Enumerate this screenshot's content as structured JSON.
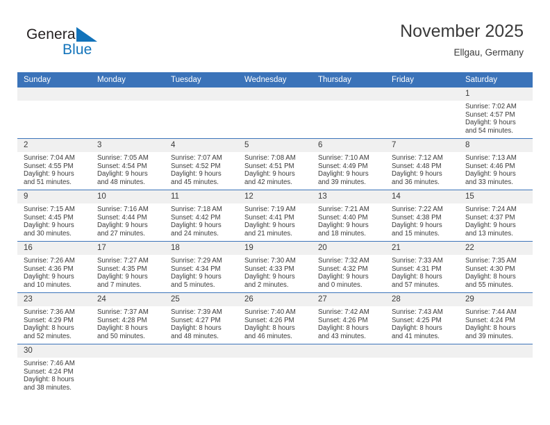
{
  "brand": {
    "name_part1": "General",
    "name_part2": "Blue",
    "flag_icon": "blue-triangle-flag",
    "color_dark": "#231f20",
    "color_blue": "#1273ba"
  },
  "header": {
    "month_title": "November 2025",
    "location": "Ellgau, Germany"
  },
  "theme": {
    "header_blue": "#3b73b9",
    "daynum_band": "#f0f0f0",
    "text": "#3a3a3a"
  },
  "calendar": {
    "weekday_headers": [
      "Sunday",
      "Monday",
      "Tuesday",
      "Wednesday",
      "Thursday",
      "Friday",
      "Saturday"
    ],
    "weeks": [
      [
        {
          "day": "",
          "lines": []
        },
        {
          "day": "",
          "lines": []
        },
        {
          "day": "",
          "lines": []
        },
        {
          "day": "",
          "lines": []
        },
        {
          "day": "",
          "lines": []
        },
        {
          "day": "",
          "lines": []
        },
        {
          "day": "1",
          "lines": [
            "Sunrise: 7:02 AM",
            "Sunset: 4:57 PM",
            "Daylight: 9 hours",
            "and 54 minutes."
          ]
        }
      ],
      [
        {
          "day": "2",
          "lines": [
            "Sunrise: 7:04 AM",
            "Sunset: 4:55 PM",
            "Daylight: 9 hours",
            "and 51 minutes."
          ]
        },
        {
          "day": "3",
          "lines": [
            "Sunrise: 7:05 AM",
            "Sunset: 4:54 PM",
            "Daylight: 9 hours",
            "and 48 minutes."
          ]
        },
        {
          "day": "4",
          "lines": [
            "Sunrise: 7:07 AM",
            "Sunset: 4:52 PM",
            "Daylight: 9 hours",
            "and 45 minutes."
          ]
        },
        {
          "day": "5",
          "lines": [
            "Sunrise: 7:08 AM",
            "Sunset: 4:51 PM",
            "Daylight: 9 hours",
            "and 42 minutes."
          ]
        },
        {
          "day": "6",
          "lines": [
            "Sunrise: 7:10 AM",
            "Sunset: 4:49 PM",
            "Daylight: 9 hours",
            "and 39 minutes."
          ]
        },
        {
          "day": "7",
          "lines": [
            "Sunrise: 7:12 AM",
            "Sunset: 4:48 PM",
            "Daylight: 9 hours",
            "and 36 minutes."
          ]
        },
        {
          "day": "8",
          "lines": [
            "Sunrise: 7:13 AM",
            "Sunset: 4:46 PM",
            "Daylight: 9 hours",
            "and 33 minutes."
          ]
        }
      ],
      [
        {
          "day": "9",
          "lines": [
            "Sunrise: 7:15 AM",
            "Sunset: 4:45 PM",
            "Daylight: 9 hours",
            "and 30 minutes."
          ]
        },
        {
          "day": "10",
          "lines": [
            "Sunrise: 7:16 AM",
            "Sunset: 4:44 PM",
            "Daylight: 9 hours",
            "and 27 minutes."
          ]
        },
        {
          "day": "11",
          "lines": [
            "Sunrise: 7:18 AM",
            "Sunset: 4:42 PM",
            "Daylight: 9 hours",
            "and 24 minutes."
          ]
        },
        {
          "day": "12",
          "lines": [
            "Sunrise: 7:19 AM",
            "Sunset: 4:41 PM",
            "Daylight: 9 hours",
            "and 21 minutes."
          ]
        },
        {
          "day": "13",
          "lines": [
            "Sunrise: 7:21 AM",
            "Sunset: 4:40 PM",
            "Daylight: 9 hours",
            "and 18 minutes."
          ]
        },
        {
          "day": "14",
          "lines": [
            "Sunrise: 7:22 AM",
            "Sunset: 4:38 PM",
            "Daylight: 9 hours",
            "and 15 minutes."
          ]
        },
        {
          "day": "15",
          "lines": [
            "Sunrise: 7:24 AM",
            "Sunset: 4:37 PM",
            "Daylight: 9 hours",
            "and 13 minutes."
          ]
        }
      ],
      [
        {
          "day": "16",
          "lines": [
            "Sunrise: 7:26 AM",
            "Sunset: 4:36 PM",
            "Daylight: 9 hours",
            "and 10 minutes."
          ]
        },
        {
          "day": "17",
          "lines": [
            "Sunrise: 7:27 AM",
            "Sunset: 4:35 PM",
            "Daylight: 9 hours",
            "and 7 minutes."
          ]
        },
        {
          "day": "18",
          "lines": [
            "Sunrise: 7:29 AM",
            "Sunset: 4:34 PM",
            "Daylight: 9 hours",
            "and 5 minutes."
          ]
        },
        {
          "day": "19",
          "lines": [
            "Sunrise: 7:30 AM",
            "Sunset: 4:33 PM",
            "Daylight: 9 hours",
            "and 2 minutes."
          ]
        },
        {
          "day": "20",
          "lines": [
            "Sunrise: 7:32 AM",
            "Sunset: 4:32 PM",
            "Daylight: 9 hours",
            "and 0 minutes."
          ]
        },
        {
          "day": "21",
          "lines": [
            "Sunrise: 7:33 AM",
            "Sunset: 4:31 PM",
            "Daylight: 8 hours",
            "and 57 minutes."
          ]
        },
        {
          "day": "22",
          "lines": [
            "Sunrise: 7:35 AM",
            "Sunset: 4:30 PM",
            "Daylight: 8 hours",
            "and 55 minutes."
          ]
        }
      ],
      [
        {
          "day": "23",
          "lines": [
            "Sunrise: 7:36 AM",
            "Sunset: 4:29 PM",
            "Daylight: 8 hours",
            "and 52 minutes."
          ]
        },
        {
          "day": "24",
          "lines": [
            "Sunrise: 7:37 AM",
            "Sunset: 4:28 PM",
            "Daylight: 8 hours",
            "and 50 minutes."
          ]
        },
        {
          "day": "25",
          "lines": [
            "Sunrise: 7:39 AM",
            "Sunset: 4:27 PM",
            "Daylight: 8 hours",
            "and 48 minutes."
          ]
        },
        {
          "day": "26",
          "lines": [
            "Sunrise: 7:40 AM",
            "Sunset: 4:26 PM",
            "Daylight: 8 hours",
            "and 46 minutes."
          ]
        },
        {
          "day": "27",
          "lines": [
            "Sunrise: 7:42 AM",
            "Sunset: 4:26 PM",
            "Daylight: 8 hours",
            "and 43 minutes."
          ]
        },
        {
          "day": "28",
          "lines": [
            "Sunrise: 7:43 AM",
            "Sunset: 4:25 PM",
            "Daylight: 8 hours",
            "and 41 minutes."
          ]
        },
        {
          "day": "29",
          "lines": [
            "Sunrise: 7:44 AM",
            "Sunset: 4:24 PM",
            "Daylight: 8 hours",
            "and 39 minutes."
          ]
        }
      ],
      [
        {
          "day": "30",
          "lines": [
            "Sunrise: 7:46 AM",
            "Sunset: 4:24 PM",
            "Daylight: 8 hours",
            "and 38 minutes."
          ]
        },
        {
          "day": "",
          "lines": []
        },
        {
          "day": "",
          "lines": []
        },
        {
          "day": "",
          "lines": []
        },
        {
          "day": "",
          "lines": []
        },
        {
          "day": "",
          "lines": []
        },
        {
          "day": "",
          "lines": []
        }
      ]
    ]
  }
}
